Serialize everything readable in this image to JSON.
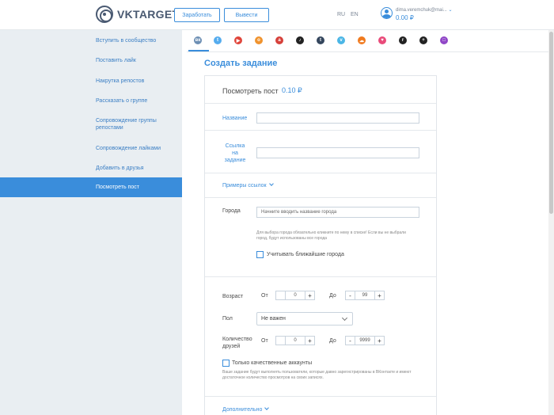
{
  "header": {
    "logo_text": "VKTARGET",
    "earn_button": "Заработать",
    "withdraw_button": "Вывести",
    "lang_ru": "RU",
    "lang_en": "EN",
    "user_email": "dima.veremchuk@mai...",
    "user_balance": "0.00 ₽"
  },
  "sidebar": {
    "items": [
      {
        "label": "Вступить в сообщество"
      },
      {
        "label": "Поставить лайк"
      },
      {
        "label": "Накрутка репостов"
      },
      {
        "label": "Рассказать о группе"
      },
      {
        "label": "Сопровождение группы репостами"
      },
      {
        "label": "Сопровождение лайками"
      },
      {
        "label": "Добавить в друзья"
      },
      {
        "label": "Посмотреть пост"
      }
    ],
    "active_index": 7
  },
  "social_tabs": [
    {
      "icon": "vk-icon",
      "color": "#6d8fb4",
      "glyph": "вк"
    },
    {
      "icon": "twitter-icon",
      "color": "#55acee",
      "glyph": "t"
    },
    {
      "icon": "youtube-icon",
      "color": "#e0453a",
      "glyph": "▶"
    },
    {
      "icon": "odnoklassniki-icon",
      "color": "#f0932e",
      "glyph": "o"
    },
    {
      "icon": "ask-icon",
      "color": "#d6403a",
      "glyph": "a"
    },
    {
      "icon": "tiktok-icon",
      "color": "#222222",
      "glyph": "♪"
    },
    {
      "icon": "tumblr-icon",
      "color": "#34465d",
      "glyph": "t"
    },
    {
      "icon": "vimeo-icon",
      "color": "#4bb6e6",
      "glyph": "v"
    },
    {
      "icon": "soundcloud-icon",
      "color": "#f07a1e",
      "glyph": "☁"
    },
    {
      "icon": "likee-icon",
      "color": "#e94b7a",
      "glyph": "♥"
    },
    {
      "icon": "reddit-icon",
      "color": "#222222",
      "glyph": "r"
    },
    {
      "icon": "plus-service-icon",
      "color": "#222222",
      "glyph": "+"
    },
    {
      "icon": "twitch-icon",
      "color": "#9046c7",
      "glyph": "□"
    }
  ],
  "page": {
    "title": "Создать задание"
  },
  "form": {
    "task_name": "Посмотреть пост",
    "task_price": "0.10 ₽",
    "name_label": "Название",
    "name_value": "",
    "link_label": "Ссылка на задание",
    "link_value": "",
    "examples_link": "Примеры ссылок",
    "city_label": "Города",
    "city_placeholder": "Начните вводить название города",
    "city_note": "Для выбора города обязательно кликните по нему в списке! Если вы не выбрали город, будут использованы все города",
    "nearby_checkbox": "Учитывать ближайшие города",
    "age_label": "Возраст",
    "from_label": "От",
    "to_label": "До",
    "age_from": "0",
    "age_to": "99",
    "gender_label": "Пол",
    "gender_value": "Не важен",
    "friends_label": "Количество друзей",
    "friends_from": "0",
    "friends_to": "9999",
    "quality_checkbox": "Только качественные аккаунты",
    "quality_note": "Ваше задание будут выполнять пользователи, которые давно зарегистрированы в ВКонтакте и имеют достаточное количество просмотров на своих записях.",
    "more_link": "Дополнительно"
  }
}
